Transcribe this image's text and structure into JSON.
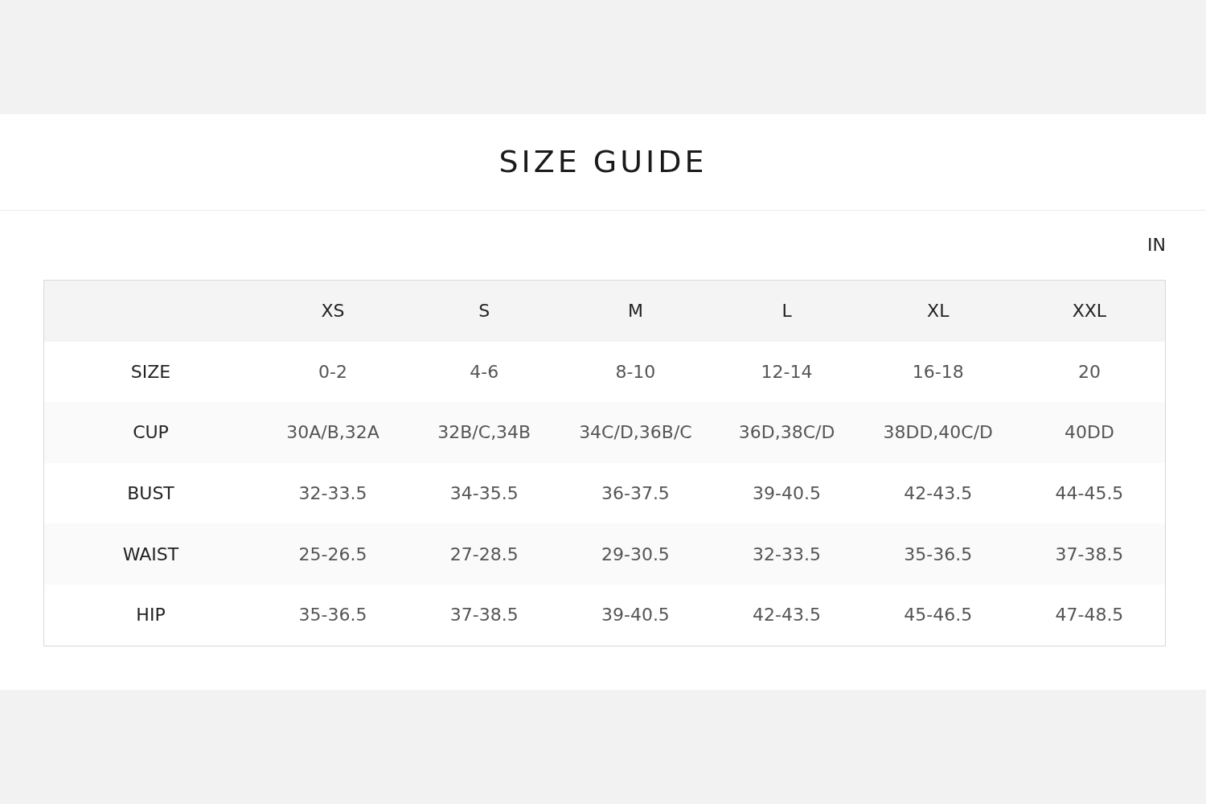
{
  "title": "SIZE GUIDE",
  "unit": "IN",
  "table": {
    "columns": [
      "XS",
      "S",
      "M",
      "L",
      "XL",
      "XXL"
    ],
    "rows": [
      {
        "label": "SIZE",
        "cells": [
          "0-2",
          "4-6",
          "8-10",
          "12-14",
          "16-18",
          "20"
        ]
      },
      {
        "label": "CUP",
        "cells": [
          "30A/B,32A",
          "32B/C,34B",
          "34C/D,36B/C",
          "36D,38C/D",
          "38DD,40C/D",
          "40DD"
        ]
      },
      {
        "label": "BUST",
        "cells": [
          "32-33.5",
          "34-35.5",
          "36-37.5",
          "39-40.5",
          "42-43.5",
          "44-45.5"
        ]
      },
      {
        "label": "WAIST",
        "cells": [
          "25-26.5",
          "27-28.5",
          "29-30.5",
          "32-33.5",
          "35-36.5",
          "37-38.5"
        ]
      },
      {
        "label": "HIP",
        "cells": [
          "35-36.5",
          "37-38.5",
          "39-40.5",
          "42-43.5",
          "45-46.5",
          "47-48.5"
        ]
      }
    ]
  }
}
